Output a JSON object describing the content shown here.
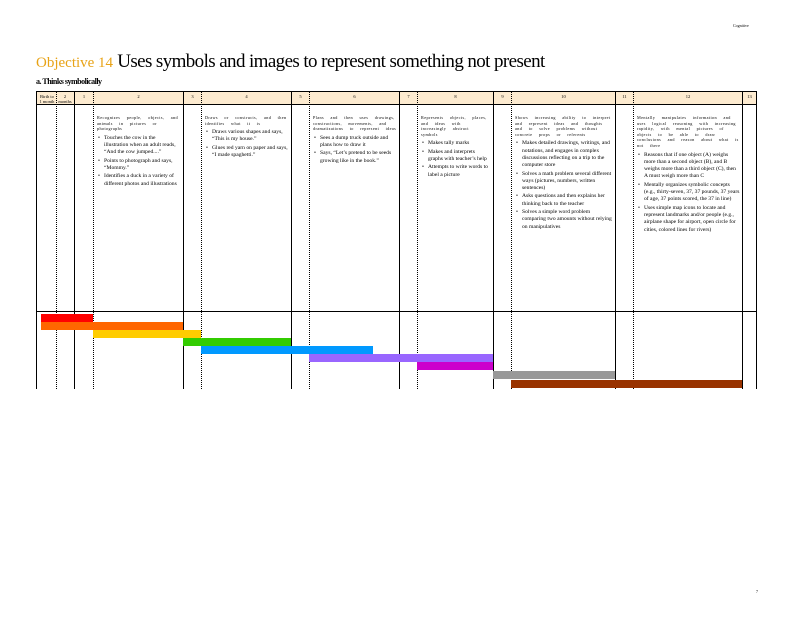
{
  "page": {
    "corner_label": "Cognitive",
    "page_number": "7"
  },
  "objective": {
    "label": "Objective 14",
    "title": "Uses symbols and images to represent something not present"
  },
  "sub_objective": "a. Thinks symbolically",
  "columns_header": [
    "Birth to 1 month",
    "2 months",
    "1",
    "2",
    "3",
    "4",
    "5",
    "6",
    "7",
    "8",
    "9",
    "10",
    "11",
    "12",
    "13"
  ],
  "levels": [
    {
      "intro": "Recognizes people, objects, and animals in pictures or photographs",
      "bullets": [
        "Touches the cow in the illustration when an adult reads, “And the cow jumped....”",
        "Points to photograph and says, “Mommy.”",
        "Identifies a duck in a variety of different photos and illustrations"
      ]
    },
    {
      "intro": "Draws or constructs, and then identifies what it is",
      "bullets": [
        "Draws various shapes and says, “This is my house.”",
        "Glues red yarn on paper and says, “I made spaghetti.”"
      ]
    },
    {
      "intro": "Plans and then uses drawings, constructions, movements, and dramatizations to represent ideas",
      "bullets": [
        "Sees a dump truck outside and plans how to draw it",
        "Says, “Let’s pretend to be seeds growing like in the book.”"
      ]
    },
    {
      "intro": "Represents objects, places, and ideas with increasingly abstract symbols",
      "bullets": [
        "Makes tally marks",
        "Makes and interprets graphs with teacher’s help",
        "Attempts to write words to label a picture"
      ]
    },
    {
      "intro": "Shows increasing ability to interpret and represent ideas and thoughts and to solve problems without concrete props or referents",
      "bullets": [
        "Makes detailed drawings, writings, and notations, and engages in complex discussions reflecting on a trip to the computer store",
        "Solves a math problem several different ways (pictures, numbers, written sentences)",
        "Asks questions and then explains her thinking back to the teacher",
        "Solves a simple word problem comparing two amounts without relying on manipulatives"
      ]
    },
    {
      "intro": "Mentally manipulates information and uses logical reasoning with increasing rapidity, with mental pictures of objects to be able to draw conclusions and reason about what is not there",
      "bullets": [
        "Reasons that if one object (A) weighs more than a second object (B), and B weighs more than a third object (C), then A must weigh more than C",
        "Mentally organizes symbolic concepts (e.g., thirty-seven, 37, 37 pounds, 37 years of age, 37 points scored, the 37 in line)",
        "Uses simple map icons to locate and represent landmarks and/or people (e.g., airplane shape for airport, open circle for cities, colored lines for rivers)"
      ]
    }
  ],
  "colors": {
    "objective_label": "#e8a317",
    "header_band": "#fdebd0",
    "bands": [
      "#ff0000",
      "#ff6600",
      "#ffcc00",
      "#33cc00",
      "#0099ff",
      "#9966ff",
      "#cc00cc",
      "#999999",
      "#993300"
    ]
  }
}
